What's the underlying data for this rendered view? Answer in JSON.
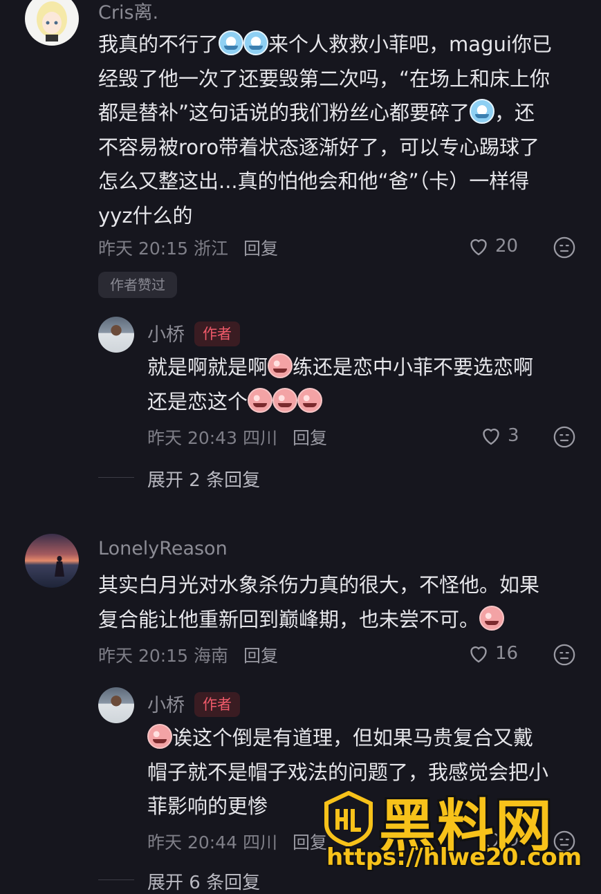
{
  "comments": [
    {
      "username": "Cris离.",
      "avatar": "anime-blonde-girl-avatar",
      "text_parts": [
        "我真的不行了",
        "来个人救救小菲吧，magui你已",
        "经毁了他一次了还要毁第二次吗，“在场上和床上你",
        "都是替补”这句话说的我们粉丝心都要碎了",
        "，还",
        "不容易被roro带着状态逐渐好了，可以专心踢球了",
        "怎么又整这出...真的怕他会和他“爸”（卡）一样得",
        "yyz什么的"
      ],
      "time": "昨天 20:15",
      "location": "浙江",
      "reply_label": "回复",
      "likes": "20",
      "tag": "作者赞过"
    },
    {
      "username": "LonelyReason",
      "avatar": "sunset-beach-avatar",
      "text_parts": [
        "其实白月光对水象杀伤力真的很大，不怪他。如果",
        "复合能让他重新回到巅峰期，也未尝不可。"
      ],
      "time": "昨天 20:15",
      "location": "海南",
      "reply_label": "回复",
      "likes": "16"
    }
  ],
  "replies": [
    {
      "username": "小桥",
      "badge": "作者",
      "text_parts": [
        "就是啊就是啊",
        "练还是恋中小菲不要选恋啊",
        "还是恋这个"
      ],
      "time": "昨天 20:43",
      "location": "四川",
      "reply_label": "回复",
      "likes": "3",
      "expand": "展开 2 条回复"
    },
    {
      "username": "小桥",
      "badge": "作者",
      "text_parts": [
        "诶这个倒是有道理，但如果马贵复合又戴",
        "帽子就不是帽子戏法的问题了，我感觉会把小",
        "菲影响的更惨"
      ],
      "time": "昨天 20:44",
      "location": "四川",
      "reply_label": "回复",
      "likes": "9",
      "expand": "展开 6 条回复"
    }
  ],
  "watermark": {
    "title": "黑料网",
    "url": "https://hlwe20.com",
    "logo": "hl-shield-logo",
    "color": "#f7c21a"
  },
  "icons": {
    "like": "heart-icon",
    "dislike": "neutral-face-icon"
  },
  "colors": {
    "background": "#16161e",
    "author_badge": "#f05a6a"
  }
}
